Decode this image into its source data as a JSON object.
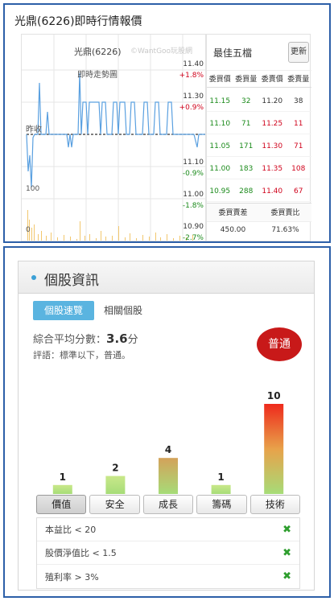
{
  "top": {
    "title": "光鼎(6226)即時行情報價",
    "chart": {
      "name": "光鼎(6226)",
      "watermark": "©WantGoo玩股網",
      "subtitle": "即時走勢圖",
      "prev_close_label": "昨收",
      "volume_label": "100",
      "zero_label": "0",
      "ticks": [
        {
          "price": "11.40",
          "pct": "+1.8%"
        },
        {
          "price": "11.30",
          "pct": "+0.9%"
        },
        {
          "price": "11.10",
          "pct": "-0.9%"
        },
        {
          "price": "11.00",
          "pct": "-1.8%"
        },
        {
          "price": "10.90",
          "pct": "-2.7%"
        }
      ]
    },
    "orderbook": {
      "title": "最佳五檔",
      "refresh_label": "更新",
      "headers": [
        "委買價",
        "委買量",
        "委賣價",
        "委賣量"
      ],
      "rows": [
        {
          "bid": "11.15",
          "bid_qty": "32",
          "ask": "11.20",
          "ask_qty": "38"
        },
        {
          "bid": "11.10",
          "bid_qty": "71",
          "ask": "11.25",
          "ask_qty": "11"
        },
        {
          "bid": "11.05",
          "bid_qty": "171",
          "ask": "11.30",
          "ask_qty": "71"
        },
        {
          "bid": "11.00",
          "bid_qty": "183",
          "ask": "11.35",
          "ask_qty": "108"
        },
        {
          "bid": "10.95",
          "bid_qty": "288",
          "ask": "11.40",
          "ask_qty": "67"
        }
      ],
      "footer_headers": [
        "委買賣差",
        "委買賣比"
      ],
      "footer_values": [
        "450.00",
        "71.63%"
      ]
    }
  },
  "panel": {
    "title": "個股資訊",
    "tabs": [
      "個股速覽",
      "相關個股"
    ],
    "score_label": "綜合平均分數：",
    "score_value": "3.6",
    "score_unit": "分",
    "comment": "評語：標準以下，普通。",
    "badge": "普通",
    "categories": [
      "價值",
      "安全",
      "成長",
      "籌碼",
      "技術"
    ],
    "criteria": [
      {
        "text": "本益比 < 20"
      },
      {
        "text": "股價淨值比 < 1.5"
      },
      {
        "text": "殖利率 > 3%"
      }
    ]
  },
  "chart_data": {
    "type": "bar",
    "categories": [
      "價值",
      "安全",
      "成長",
      "籌碼",
      "技術"
    ],
    "values": [
      1,
      2,
      4,
      1,
      10
    ]
  }
}
